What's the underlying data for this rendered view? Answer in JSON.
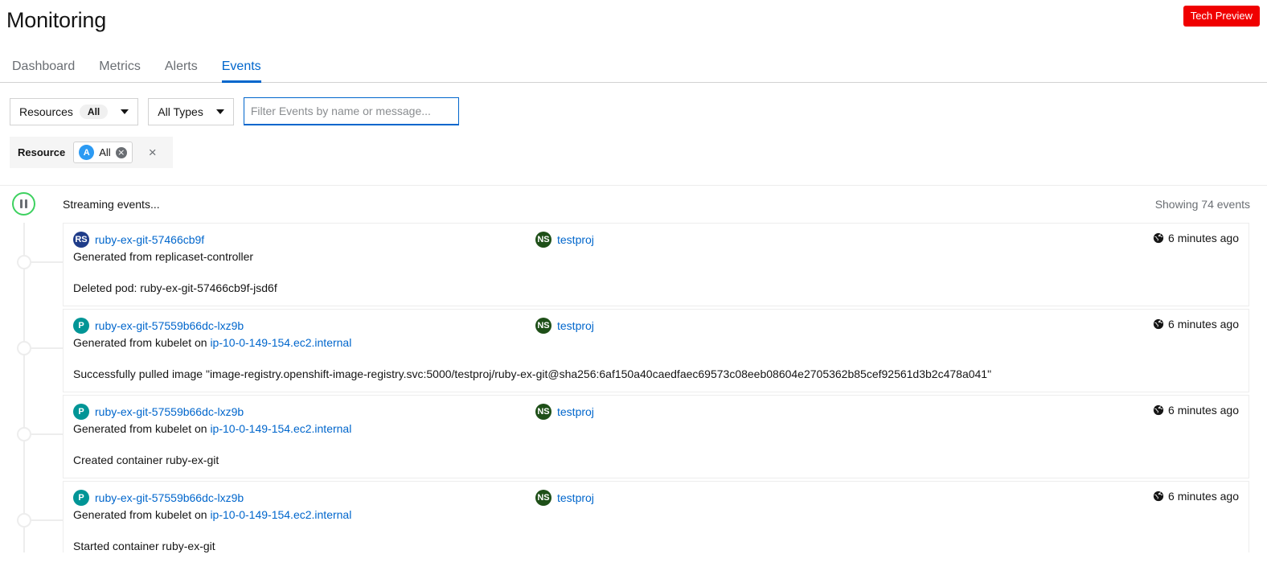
{
  "header": {
    "title": "Monitoring",
    "tech_preview_label": "Tech Preview"
  },
  "tabs": [
    {
      "label": "Dashboard",
      "active": false
    },
    {
      "label": "Metrics",
      "active": false
    },
    {
      "label": "Alerts",
      "active": false
    },
    {
      "label": "Events",
      "active": true
    }
  ],
  "toolbar": {
    "resources_dropdown": {
      "label": "Resources",
      "pill": "All"
    },
    "types_dropdown": {
      "label": "All Types"
    },
    "search": {
      "placeholder": "Filter Events by name or message...",
      "value": ""
    },
    "chips": {
      "group_label": "Resource",
      "chip_badge": "A",
      "chip_label": "All",
      "chip_close": "×",
      "clear_all": "×"
    }
  },
  "stream": {
    "status_label": "Streaming events...",
    "count_label": "Showing 74 events",
    "toggle_state": "streaming"
  },
  "events": [
    {
      "kind_badge": "RS",
      "kind_class": "badge-rs",
      "name": "ruby-ex-git-57466cb9f",
      "source_prefix": "Generated from replicaset-controller",
      "source_link": "",
      "namespace_badge": "NS",
      "namespace": "testproj",
      "timestamp": "6 minutes ago",
      "message": "Deleted pod: ruby-ex-git-57466cb9f-jsd6f"
    },
    {
      "kind_badge": "P",
      "kind_class": "badge-p",
      "name": "ruby-ex-git-57559b66dc-lxz9b",
      "source_prefix": "Generated from kubelet on ",
      "source_link": "ip-10-0-149-154.ec2.internal",
      "namespace_badge": "NS",
      "namespace": "testproj",
      "timestamp": "6 minutes ago",
      "message": "Successfully pulled image \"image-registry.openshift-image-registry.svc:5000/testproj/ruby-ex-git@sha256:6af150a40caedfaec69573c08eeb08604e2705362b85cef92561d3b2c478a041\""
    },
    {
      "kind_badge": "P",
      "kind_class": "badge-p",
      "name": "ruby-ex-git-57559b66dc-lxz9b",
      "source_prefix": "Generated from kubelet on ",
      "source_link": "ip-10-0-149-154.ec2.internal",
      "namespace_badge": "NS",
      "namespace": "testproj",
      "timestamp": "6 minutes ago",
      "message": "Created container ruby-ex-git"
    },
    {
      "kind_badge": "P",
      "kind_class": "badge-p",
      "name": "ruby-ex-git-57559b66dc-lxz9b",
      "source_prefix": "Generated from kubelet on ",
      "source_link": "ip-10-0-149-154.ec2.internal",
      "namespace_badge": "NS",
      "namespace": "testproj",
      "timestamp": "6 minutes ago",
      "message": "Started container ruby-ex-git"
    }
  ],
  "colors": {
    "accent": "#0066cc",
    "danger": "#f00000",
    "success": "#3ed160",
    "replicaset_badge": "#1f3c89",
    "pod_badge": "#009596",
    "namespace_badge": "#1e4f18",
    "all_chip_badge": "#2b9af3"
  }
}
